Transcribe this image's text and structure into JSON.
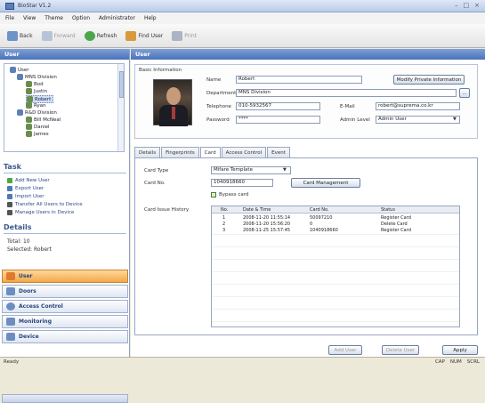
{
  "window": {
    "title": "BioStar V1.2",
    "controls": [
      "–",
      "□",
      "×"
    ]
  },
  "menu": [
    "File",
    "View",
    "Theme",
    "Option",
    "Administrator",
    "Help"
  ],
  "toolbar": {
    "back": "Back",
    "forward": "Forward",
    "refresh": "Refresh",
    "find_user": "Find User",
    "print": "Print"
  },
  "left": {
    "header": "User",
    "tree": [
      {
        "label": "User",
        "level": 0
      },
      {
        "label": "MNS Division",
        "level": 1
      },
      {
        "label": "Bod",
        "level": 2
      },
      {
        "label": "Justin",
        "level": 2
      },
      {
        "label": "Robert",
        "level": 2
      },
      {
        "label": "Ryan",
        "level": 2
      },
      {
        "label": "R&D Division",
        "level": 1
      },
      {
        "label": "Bill McNeal",
        "level": 2
      },
      {
        "label": "Daniel",
        "level": 2
      },
      {
        "label": "James",
        "level": 2
      }
    ],
    "task_title": "Task",
    "tasks": [
      "Add New User",
      "Export User",
      "Import User",
      "Transfer All Users to Device",
      "Manage Users in Device"
    ],
    "details_title": "Details",
    "details_total": "Total: 10",
    "details_selected": "Selected: Robert",
    "nav": [
      {
        "label": "User",
        "active": true
      },
      {
        "label": "Doors",
        "active": false
      },
      {
        "label": "Access Control",
        "active": false
      },
      {
        "label": "Monitoring",
        "active": false
      },
      {
        "label": "Device",
        "active": false
      }
    ]
  },
  "right": {
    "header": "User",
    "basic_info_label": "Basic Information",
    "name_label": "Name",
    "name_value": "Robert",
    "department_label": "Department",
    "department_value": "MNS Division",
    "telephone_label": "Telephone",
    "telephone_value": "010-5932567",
    "password_label": "Password",
    "password_value": "****",
    "email_label": "E-Mail",
    "email_value": "robert@suprema.co.kr",
    "admin_level_label": "Admin Level",
    "admin_level_value": "Admin User",
    "modify_private_btn": "Modify Private Information",
    "dept_browse_btn": "...",
    "tabs": [
      "Details",
      "Fingerprints",
      "Card",
      "Access Control",
      "Event"
    ],
    "active_tab": "Card",
    "card_type_label": "Card Type",
    "card_type_value": "Mifare Template",
    "card_no_label": "Card No.",
    "card_no_value": "1040918660",
    "card_mgmt_btn": "Card Management",
    "bypass_label": "Bypass card",
    "history_label": "Card Issue History",
    "history_columns": [
      "No.",
      "Date & Time",
      "Card No.",
      "Status"
    ],
    "history_rows": [
      {
        "no": "1",
        "datetime": "2008-11-20 11:55:14",
        "card": "50097210",
        "status": "Register Card"
      },
      {
        "no": "2",
        "datetime": "2008-11-20 15:56:20",
        "card": "0",
        "status": "Delete Card"
      },
      {
        "no": "3",
        "datetime": "2008-11-25 15:57:45",
        "card": "1040918660",
        "status": "Register Card"
      }
    ],
    "bottom_buttons": [
      "Add User",
      "Delete User",
      "Apply"
    ]
  },
  "status": {
    "left": "Ready",
    "right": [
      "CAP",
      "NUM",
      "SCRL"
    ]
  }
}
